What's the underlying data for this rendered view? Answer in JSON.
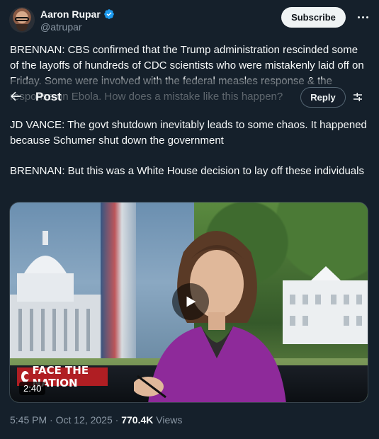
{
  "author": {
    "name": "Aaron Rupar",
    "handle": "@atrupar"
  },
  "header": {
    "subscribe_label": "Subscribe",
    "more_icon": "more-horizontal-icon"
  },
  "tweet": {
    "paragraphs": [
      "BRENNAN: CBS confirmed that the Trump administration rescinded some of the layoffs of hundreds of CDC scientists who were mistakenly laid off on Friday. Some were involved with the federal measles response & the response on Ebola. How does a mistake like this happen?",
      "JD VANCE: The govt shutdown inevitably leads to some chaos. It happened because Schumer shut down the government",
      "BRENNAN: But this was a White House decision to lay off these individuals"
    ]
  },
  "overlay_bar": {
    "title": "Post",
    "reply_label": "Reply",
    "back_icon": "back-arrow-icon",
    "filter_icon": "filter-sliders-icon"
  },
  "video": {
    "duration": "2:40",
    "logo_text": "FACE THE NATION",
    "logo_left": "FACE",
    "logo_mid": "THE",
    "logo_right": "NATION",
    "play_icon": "play-icon"
  },
  "meta": {
    "time": "5:45 PM",
    "date": "Oct 12, 2025",
    "separator": "·",
    "views_count": "770.4K",
    "views_label": "Views"
  },
  "colors": {
    "background": "#15202b",
    "accent_verified": "#1d9bf0",
    "secondary_text": "#8b98a5",
    "cbs_red": "#b01e23"
  }
}
